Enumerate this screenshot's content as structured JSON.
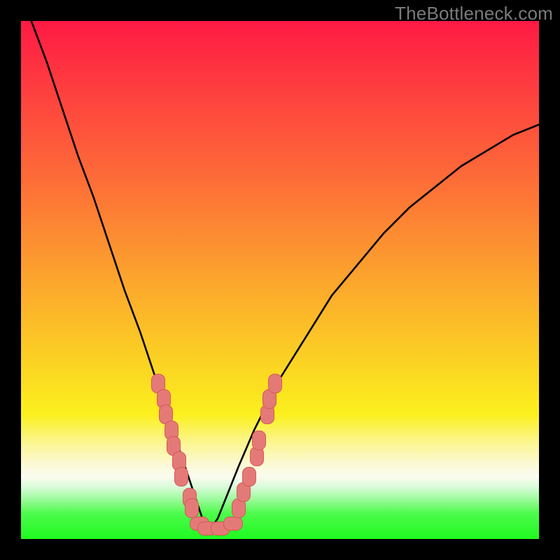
{
  "watermark": "TheBottleneck.com",
  "colors": {
    "gradient_top": "#fe1944",
    "gradient_mid1": "#fd6b38",
    "gradient_mid2": "#fbd323",
    "gradient_mid3": "#fbf589",
    "gradient_bottom": "#1ffa1f",
    "curve": "#000000",
    "marker_fill": "#e47a77",
    "marker_stroke": "#d35a57",
    "frame": "#000000",
    "watermark_text": "#7b7b7b"
  },
  "chart_data": {
    "type": "line",
    "title": "",
    "xlabel": "",
    "ylabel": "",
    "x_range": [
      0,
      100
    ],
    "y_range": [
      0,
      100
    ],
    "note": "V-shaped bottleneck curve. Axes have no numeric tick labels in the source image; coordinates are read in percentage of plot width/height with origin at bottom-left. Minimum of curve is near x≈36, y≈1.",
    "series": [
      {
        "name": "bottleneck-curve",
        "x": [
          2,
          5,
          8,
          11,
          14,
          17,
          20,
          23,
          26,
          28,
          30,
          32,
          34,
          36,
          38,
          40,
          42,
          45,
          50,
          55,
          60,
          65,
          70,
          75,
          80,
          85,
          90,
          95,
          100
        ],
        "y": [
          100,
          92,
          83,
          74,
          66,
          57,
          48,
          40,
          31,
          25,
          19,
          13,
          7,
          1,
          4,
          9,
          14,
          21,
          31,
          39,
          47,
          53,
          59,
          64,
          68,
          72,
          75,
          78,
          80
        ]
      }
    ],
    "markers": {
      "description": "Salmon-colored lozenge markers clustered near the bottom of the V (within the green/yellow band, roughly y ≤ 25).",
      "points": [
        {
          "x": 26.5,
          "y": 30
        },
        {
          "x": 27.5,
          "y": 27
        },
        {
          "x": 28.0,
          "y": 24
        },
        {
          "x": 29.0,
          "y": 21
        },
        {
          "x": 29.5,
          "y": 18
        },
        {
          "x": 30.5,
          "y": 15
        },
        {
          "x": 31.0,
          "y": 12
        },
        {
          "x": 32.5,
          "y": 8
        },
        {
          "x": 33.0,
          "y": 6
        },
        {
          "x": 34.5,
          "y": 3
        },
        {
          "x": 36.0,
          "y": 2
        },
        {
          "x": 38.5,
          "y": 2
        },
        {
          "x": 41.0,
          "y": 3
        },
        {
          "x": 42.0,
          "y": 6
        },
        {
          "x": 43.0,
          "y": 9
        },
        {
          "x": 44.0,
          "y": 12
        },
        {
          "x": 45.5,
          "y": 16
        },
        {
          "x": 46.0,
          "y": 19
        },
        {
          "x": 47.5,
          "y": 24
        },
        {
          "x": 48.0,
          "y": 27
        },
        {
          "x": 49.0,
          "y": 30
        }
      ]
    }
  }
}
